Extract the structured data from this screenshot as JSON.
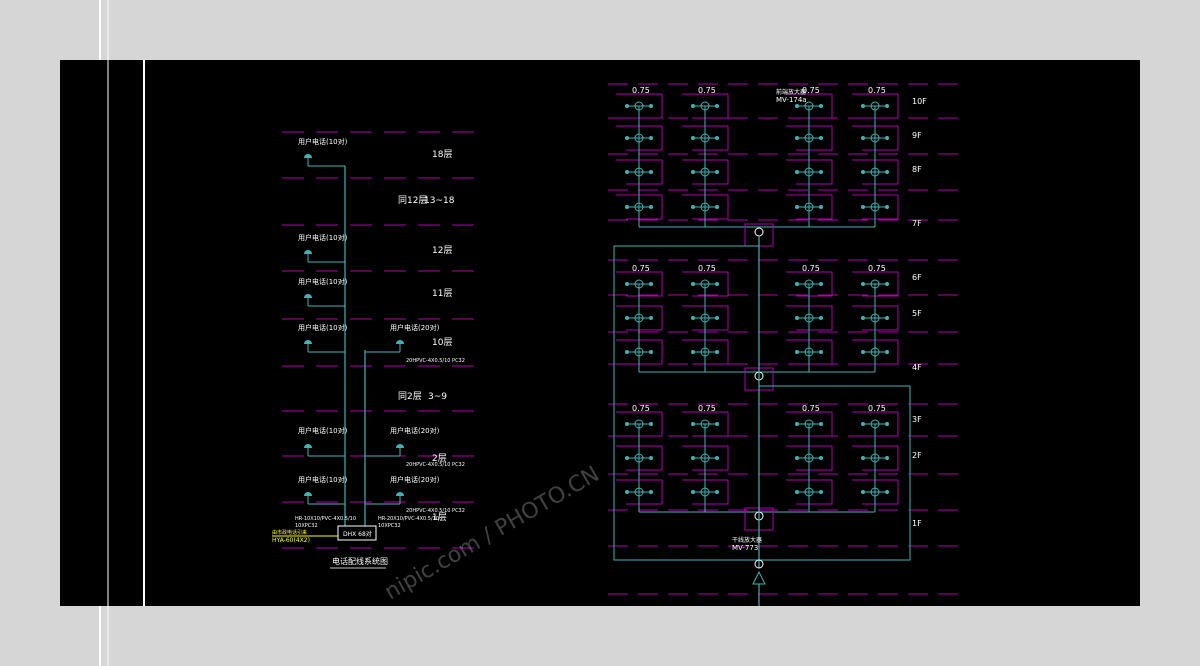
{
  "colors": {
    "background": "#d6d6d6",
    "drawing_background": "#000000",
    "floor_lines": "#b000b0",
    "wiring": "#3fb3b3",
    "text": "#ffffff",
    "highlight": "#ffff00"
  },
  "left_diagram": {
    "title": "电话配线系统图",
    "floor_labels": [
      "18层",
      "13~18",
      "12层",
      "11层",
      "10层",
      "3~9",
      "2层",
      "1层"
    ],
    "zone_labels": [
      "同12层",
      "同2层"
    ],
    "box_label": "DHX 68对",
    "box_text": "DHX 68对",
    "outlet_left": "用户电话(10对)",
    "outlet_right": "用户电话(20对)",
    "cable_annotation_1": "20HPVC-4X0.5/10 PC32",
    "cable_annotation_2": "HR-20X10/PVC-4X0.5/10",
    "cable_annotation_3": "HR-10X10/PVC-4X0.5/10",
    "cable_annotation_4": "10XPC32",
    "incoming_label": "由市政电话引来",
    "incoming_cable": "HYA-60(4X2)"
  },
  "right_diagram": {
    "floors": [
      "10F",
      "9F",
      "8F",
      "7F",
      "6F",
      "5F",
      "4F",
      "3F",
      "2F",
      "1F"
    ],
    "tv_value": "0.75",
    "amp_label_top": "前端放大器",
    "amp_model_top": "MV-174a",
    "amp_label_bottom": "干线放大器",
    "amp_model_bottom": "MV-773"
  },
  "watermark": "nipic.com / PHOTO.CN"
}
